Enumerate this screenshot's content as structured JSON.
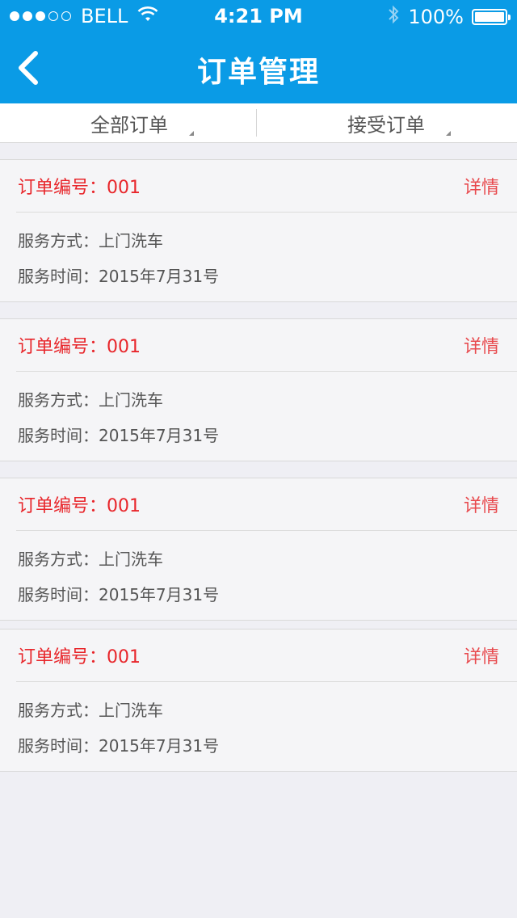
{
  "status_bar": {
    "carrier": "BELL",
    "time": "4:21 PM",
    "battery_text": "100%",
    "signal_dots_filled": 3,
    "signal_dots_total": 5
  },
  "nav": {
    "title": "订单管理",
    "back_icon": "chevron-left-icon",
    "color": "#0a9be6"
  },
  "tabs": [
    {
      "label": "全部订单"
    },
    {
      "label": "接受订单"
    }
  ],
  "orders": [
    {
      "order_label": "订单编号：001",
      "detail_label": "详情",
      "service_method": "服务方式：上门洗车",
      "service_time": "服务时间：2015年7月31号"
    },
    {
      "order_label": "订单编号：001",
      "detail_label": "详情",
      "service_method": "服务方式：上门洗车",
      "service_time": "服务时间：2015年7月31号"
    },
    {
      "order_label": "订单编号：001",
      "detail_label": "详情",
      "service_method": "服务方式：上门洗车",
      "service_time": "服务时间：2015年7月31号"
    },
    {
      "order_label": "订单编号：001",
      "detail_label": "详情",
      "service_method": "服务方式：上门洗车",
      "service_time": "服务时间：2015年7月31号"
    }
  ],
  "colors": {
    "accent": "#0a9be6",
    "order_red": "#e8262b",
    "background": "#efeff4"
  }
}
